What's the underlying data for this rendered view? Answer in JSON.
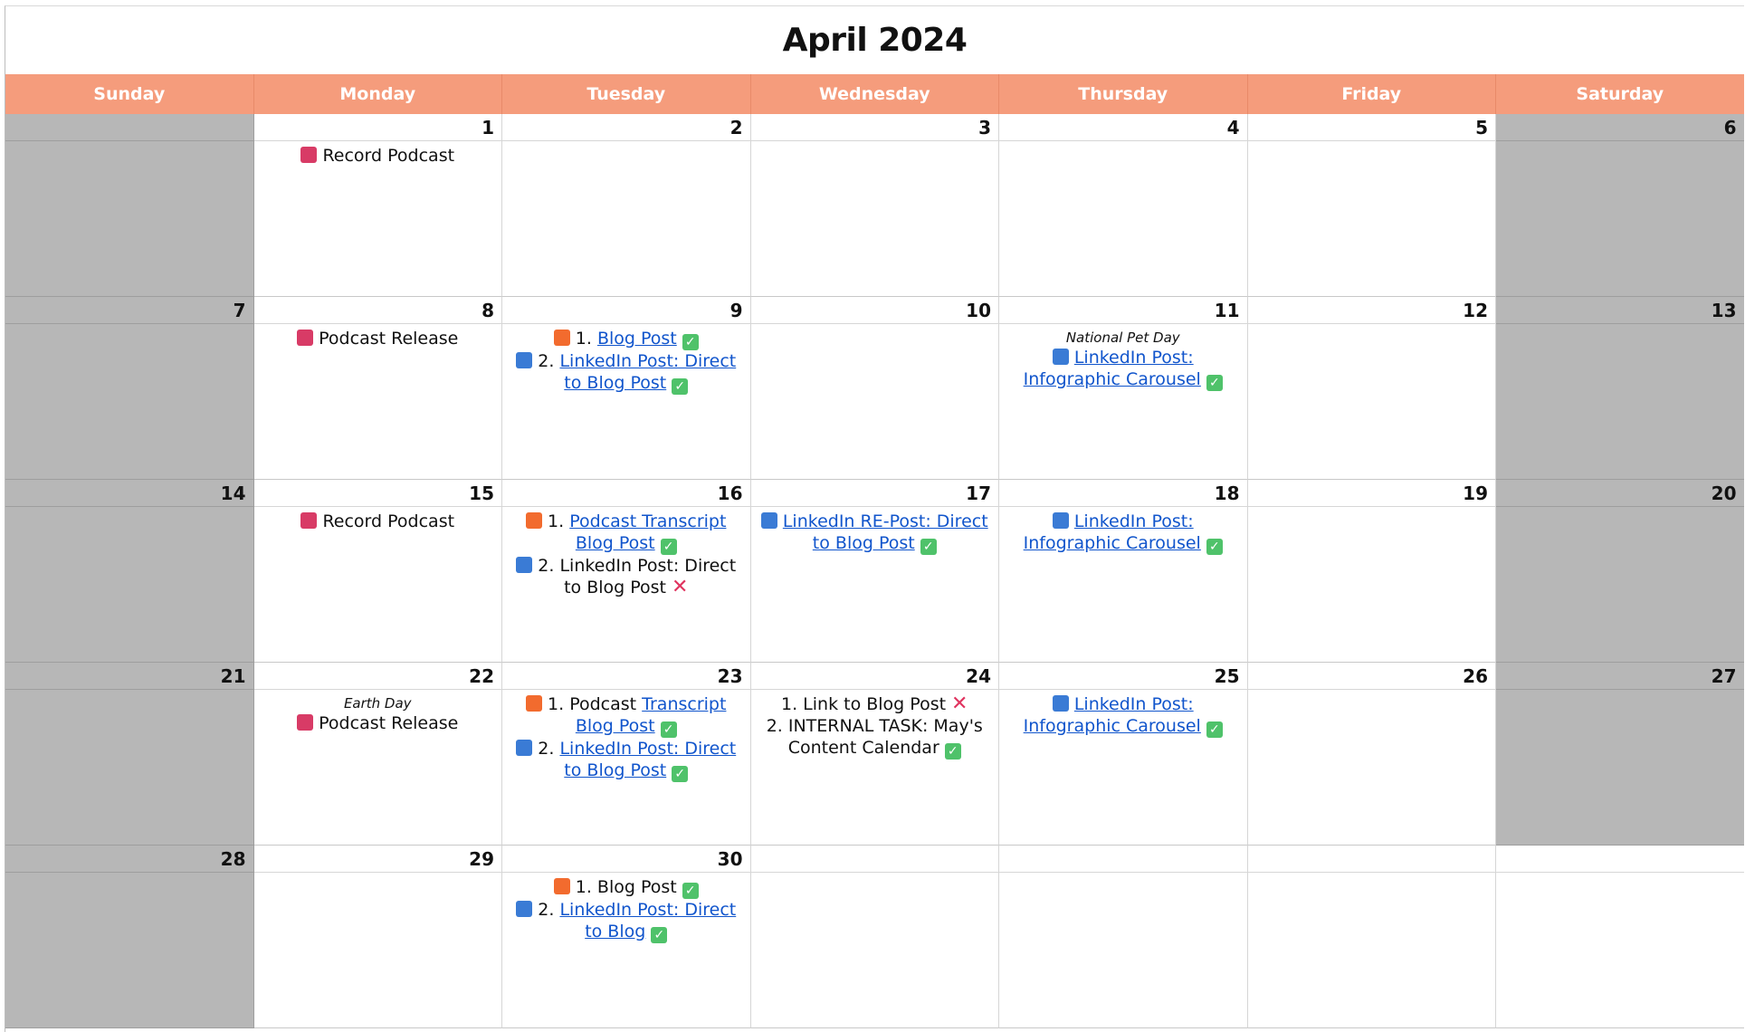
{
  "calendar": {
    "title": "April 2024",
    "weekdays": [
      "Sunday",
      "Monday",
      "Tuesday",
      "Wednesday",
      "Thursday",
      "Friday",
      "Saturday"
    ],
    "colors": {
      "header_bg": "#f59c7c",
      "weekend_bg": "#b7b7b7",
      "link": "#1155cc",
      "podcast_tag": "#d83b66",
      "blog_tag": "#f26b2e",
      "linkedin_tag": "#3a7bd5",
      "done_check": "#4fc26a",
      "not_done_cross": "#e0345f"
    },
    "weeks": [
      [
        "",
        "1",
        "2",
        "3",
        "4",
        "5",
        "6"
      ],
      [
        "7",
        "8",
        "9",
        "10",
        "11",
        "12",
        "13"
      ],
      [
        "14",
        "15",
        "16",
        "17",
        "18",
        "19",
        "20"
      ],
      [
        "21",
        "22",
        "23",
        "24",
        "25",
        "26",
        "27"
      ],
      [
        "28",
        "29",
        "30",
        "",
        "",
        "",
        ""
      ]
    ],
    "events": {
      "apr1": {
        "text": "Record Podcast"
      },
      "apr8": {
        "text": "Podcast Release"
      },
      "apr9": {
        "item1_num": "1.",
        "item1_link": "Blog Post",
        "item2_num": "2.",
        "item2_link_a": "LinkedIn Post: Direct",
        "item2_link_b": "to Blog Post"
      },
      "apr11": {
        "note": "National Pet Day",
        "link_a": "LinkedIn Post:",
        "link_b": "Infographic Carousel"
      },
      "apr15": {
        "text": "Record Podcast"
      },
      "apr16": {
        "item1_num": "1.",
        "item1_link_a": "Podcast Transcript",
        "item1_link_b": "Blog Post",
        "item2_a": "2. LinkedIn Post: Direct",
        "item2_b": "to Blog Post"
      },
      "apr17": {
        "link_a": "LinkedIn RE-Post: Direct",
        "link_b": "to Blog Post"
      },
      "apr18": {
        "link_a": "LinkedIn Post:",
        "link_b": "Infographic Carousel"
      },
      "apr22": {
        "note": "Earth Day",
        "text": "Podcast Release"
      },
      "apr23": {
        "item1_text": "1. Podcast",
        "item1_link_a": "Transcript",
        "item1_link_b": "Blog Post",
        "item2_num": "2.",
        "item2_link_a": "LinkedIn Post: Direct",
        "item2_link_b": "to Blog Post"
      },
      "apr24": {
        "line1": "1. Link to Blog Post",
        "line2": "2. INTERNAL TASK: May's",
        "line3": "Content Calendar"
      },
      "apr25": {
        "link_a": "LinkedIn Post:",
        "link_b": "Infographic Carousel"
      },
      "apr30": {
        "item1": "1. Blog Post",
        "item2_num": "2.",
        "item2_link_a": "LinkedIn Post: Direct",
        "item2_link_b": "to Blog"
      }
    }
  }
}
